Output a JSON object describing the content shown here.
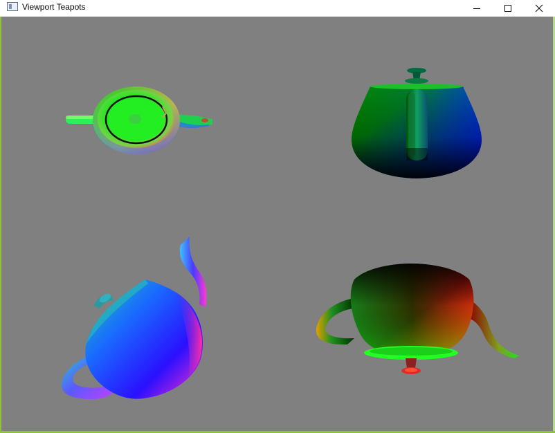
{
  "window": {
    "title": "Viewport Teapots",
    "icon": "app-window-icon",
    "controls": [
      "minimize-icon",
      "maximize-icon",
      "close-icon"
    ]
  },
  "viewport": {
    "background": "#808080",
    "panes": [
      {
        "name": "top view",
        "icon": "teapot-top-view"
      },
      {
        "name": "front view",
        "icon": "teapot-front-view"
      },
      {
        "name": "perspective view",
        "icon": "teapot-perspective-view"
      },
      {
        "name": "bottom view",
        "icon": "teapot-bottom-view"
      }
    ]
  }
}
